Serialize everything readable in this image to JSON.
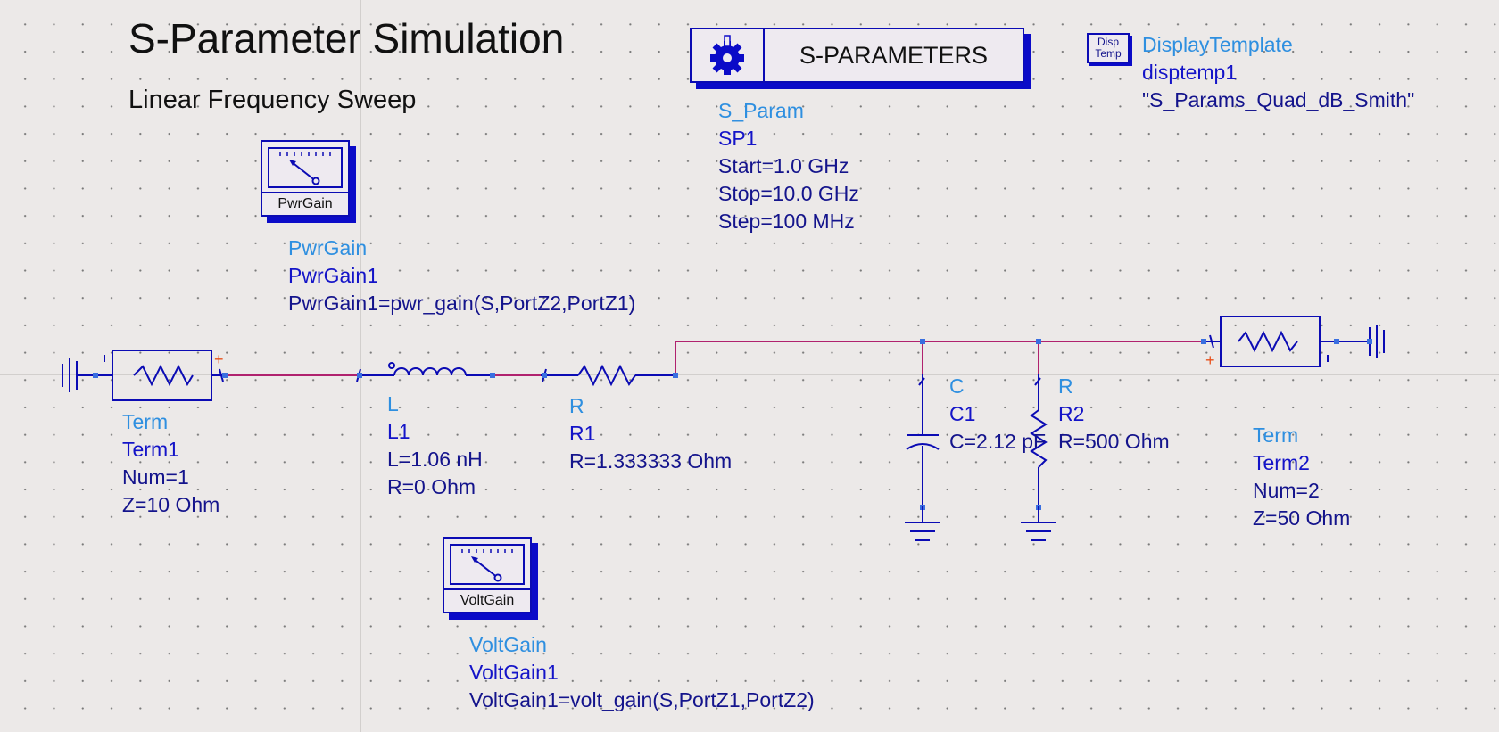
{
  "header": {
    "title": "S-Parameter Simulation",
    "subtitle": "Linear Frequency Sweep"
  },
  "sparam_block": {
    "box_label": "S-PARAMETERS",
    "type": "S_Param",
    "instance": "SP1",
    "params": [
      "Start=1.0 GHz",
      "Stop=10.0 GHz",
      "Step=100 MHz"
    ]
  },
  "display_template": {
    "icon_line1": "Disp",
    "icon_line2": "Temp",
    "type": "DisplayTemplate",
    "instance": "disptemp1",
    "value": "\"S_Params_Quad_dB_Smith\""
  },
  "pwrgain": {
    "caption": "PwrGain",
    "type": "PwrGain",
    "instance": "PwrGain1",
    "expr": "PwrGain1=pwr_gain(S,PortZ2,PortZ1)"
  },
  "voltgain": {
    "caption": "VoltGain",
    "type": "VoltGain",
    "instance": "VoltGain1",
    "expr": "VoltGain1=volt_gain(S,PortZ1,PortZ2)"
  },
  "term1": {
    "type": "Term",
    "instance": "Term1",
    "params": [
      "Num=1",
      "Z=10 Ohm"
    ]
  },
  "term2": {
    "type": "Term",
    "instance": "Term2",
    "params": [
      "Num=2",
      "Z=50 Ohm"
    ]
  },
  "inductor": {
    "type": "L",
    "instance": "L1",
    "params": [
      "L=1.06 nH",
      "R=0 Ohm"
    ]
  },
  "resistor1": {
    "type": "R",
    "instance": "R1",
    "params": [
      "R=1.333333 Ohm"
    ]
  },
  "capacitor": {
    "type": "C",
    "instance": "C1",
    "params": [
      "C=2.12 pF"
    ]
  },
  "resistor2": {
    "type": "R",
    "instance": "R2",
    "params": [
      "R=500 Ohm"
    ]
  },
  "colors": {
    "wire": "#b0226e",
    "component": "#0b0bb4",
    "pin": "#3a6fe0",
    "type_label": "#2e8fe0",
    "instance_label": "#1414c8",
    "param_label": "#14148c",
    "polarity_plus": "#e8501a",
    "background": "#ece9e8"
  },
  "icons": [
    "gear-icon",
    "meter-icon",
    "resistor-symbol",
    "inductor-symbol",
    "capacitor-symbol",
    "ground-symbol"
  ]
}
